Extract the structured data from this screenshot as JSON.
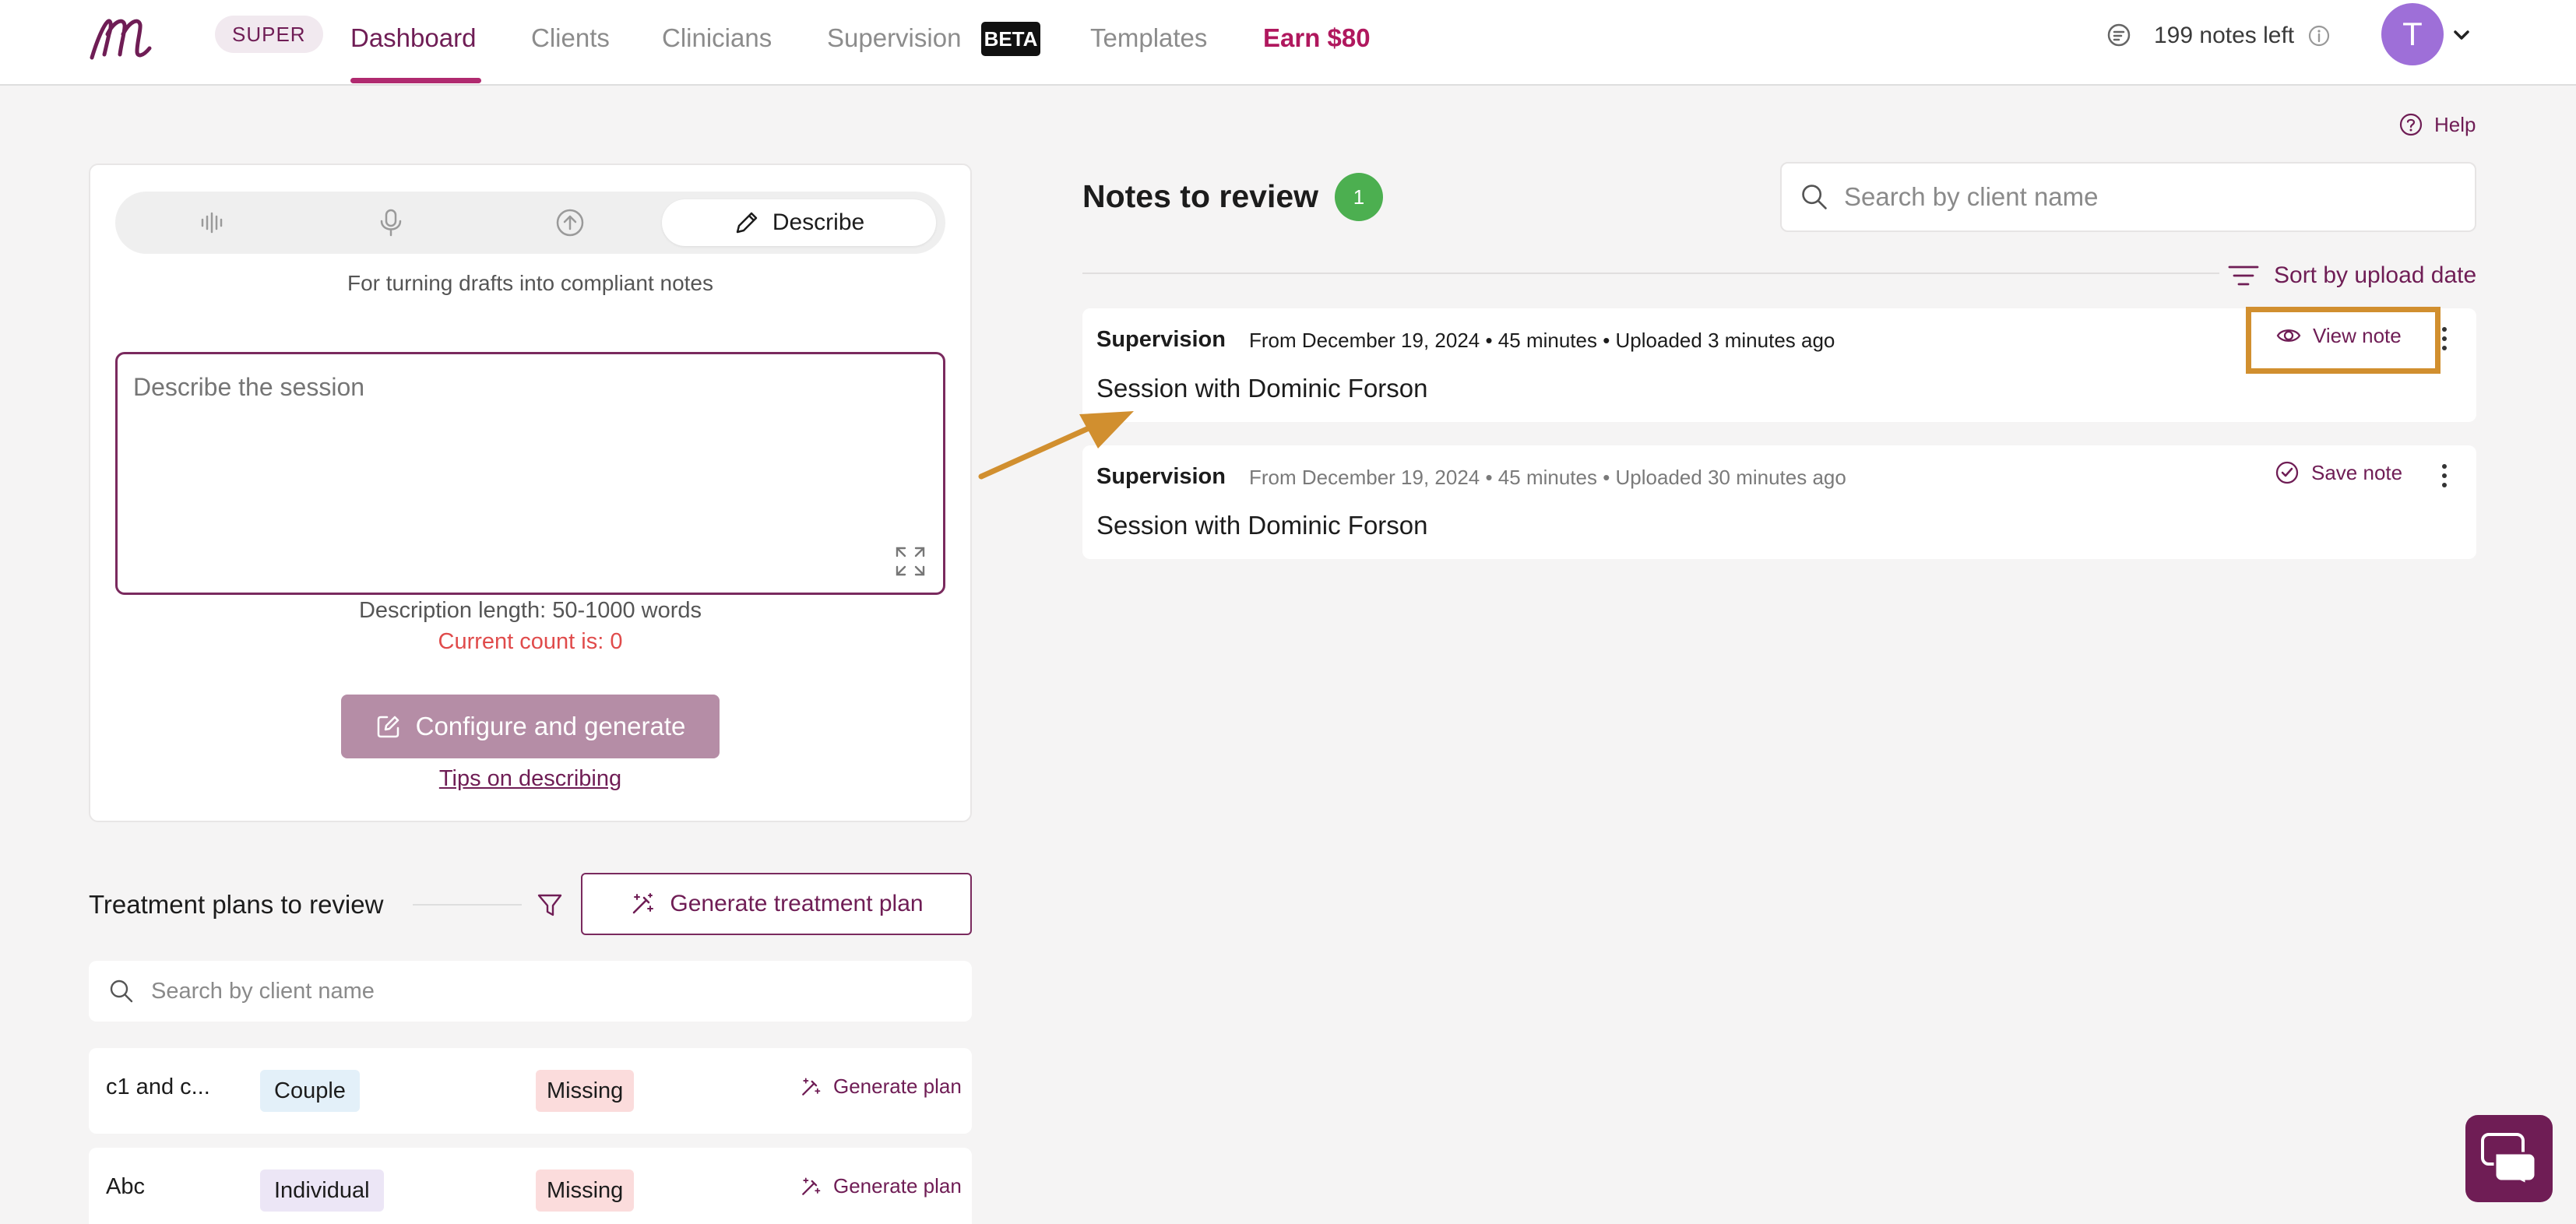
{
  "nav": {
    "badge": "SUPER",
    "links": [
      "Dashboard",
      "Clients",
      "Clinicians",
      "Supervision",
      "Templates",
      "Earn $80"
    ],
    "beta": "BETA",
    "notes_left": "199 notes left",
    "avatar_initial": "T"
  },
  "help": "Help",
  "describe": {
    "mode_label": "Describe",
    "hint": "For turning drafts into compliant notes",
    "placeholder": "Describe the session",
    "length": "Description length: 50-1000 words",
    "count": "Current count is: 0",
    "configure": "Configure and generate",
    "tips": "Tips on describing"
  },
  "treatment": {
    "title": "Treatment plans to review",
    "generate_button": "Generate treatment plan",
    "search_placeholder": "Search by client name",
    "rows": [
      {
        "name": "c1 and c...",
        "type": "Couple",
        "status": "Missing",
        "action": "Generate plan"
      },
      {
        "name": "Abc",
        "type": "Individual",
        "status": "Missing",
        "action": "Generate plan"
      }
    ]
  },
  "notes": {
    "title": "Notes to review",
    "count": "1",
    "search_placeholder": "Search by client name",
    "sort": "Sort by upload date",
    "items": [
      {
        "type": "Supervision",
        "meta": "From December 19, 2024 • 45 minutes • Uploaded 3 minutes ago",
        "title": "Session with Dominic Forson",
        "action": "View note"
      },
      {
        "type": "Supervision",
        "meta": "From December 19, 2024 • 45 minutes • Uploaded 30 minutes ago",
        "title": "Session with Dominic Forson",
        "action": "Save note"
      }
    ]
  },
  "colors": {
    "brand": "#6f1d55",
    "accent": "#b02a6f",
    "highlight": "#d18f2f",
    "success": "#4caf50",
    "danger": "#e04b4b"
  }
}
